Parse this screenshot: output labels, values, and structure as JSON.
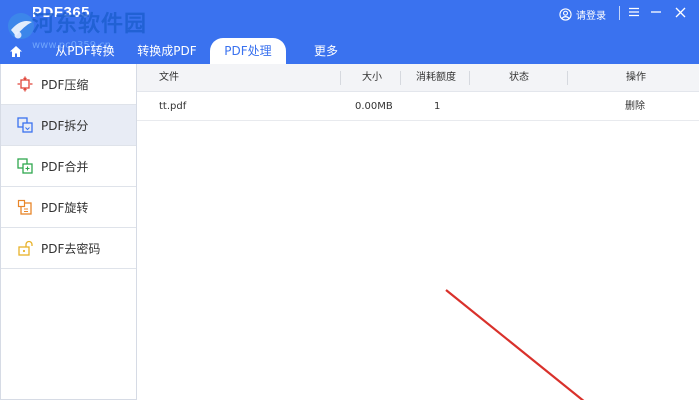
{
  "app": {
    "title": "PDF365",
    "watermark_text": "河东软件园",
    "watermark_url": "www.pc0359.cn"
  },
  "header": {
    "login_label": "请登录",
    "icons": [
      "user-icon",
      "menu-icon",
      "minimize-icon",
      "close-icon"
    ]
  },
  "tabs": [
    {
      "label": "从PDF转换"
    },
    {
      "label": "转换成PDF"
    },
    {
      "label": "PDF处理",
      "active": true
    },
    {
      "label": "更多"
    }
  ],
  "sidebar": {
    "items": [
      {
        "label": "PDF压缩",
        "icon": "compress-icon",
        "color": "#e0463a"
      },
      {
        "label": "PDF拆分",
        "icon": "split-icon",
        "color": "#3a72ef",
        "active": true
      },
      {
        "label": "PDF合并",
        "icon": "merge-icon",
        "color": "#2fa84f"
      },
      {
        "label": "PDF旋转",
        "icon": "rotate-icon",
        "color": "#e8862a"
      },
      {
        "label": "PDF去密码",
        "icon": "unlock-icon",
        "color": "#e8b22a"
      }
    ]
  },
  "table": {
    "columns": [
      "文件",
      "大小",
      "消耗额度",
      "状态",
      "操作"
    ],
    "rows": [
      {
        "file": "tt.pdf",
        "size": "0.00MB",
        "quota": "1",
        "status": "",
        "action": "删除"
      }
    ]
  },
  "colors": {
    "header_bg": "#3a72ef",
    "active_tab_text": "#3a72ef",
    "annotation_arrow": "#d9312b"
  }
}
